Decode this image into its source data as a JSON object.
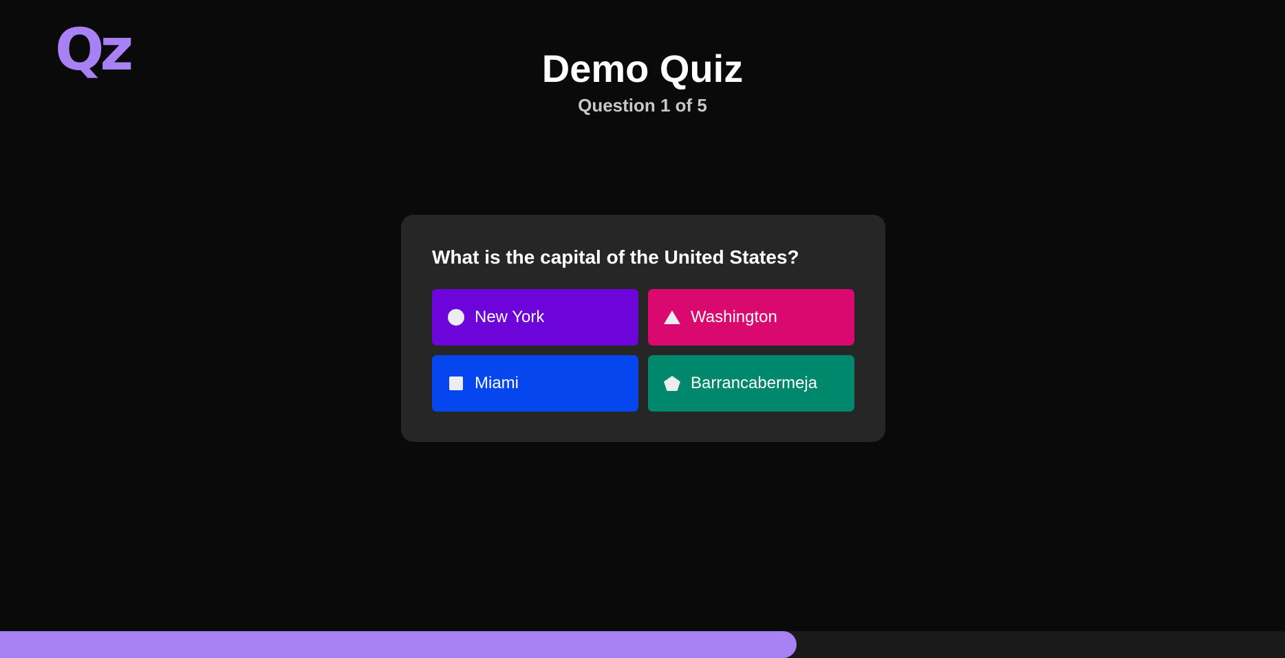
{
  "logo": {
    "text": "Qz",
    "color": "#a882f5"
  },
  "header": {
    "title": "Demo Quiz",
    "subtitle": "Question 1 of 5"
  },
  "question": {
    "text": "What is the capital of the United States?",
    "answers": [
      {
        "label": "New York",
        "icon": "circle-icon",
        "color": "#6d05db"
      },
      {
        "label": "Washington",
        "icon": "triangle-icon",
        "color": "#d90970"
      },
      {
        "label": "Miami",
        "icon": "square-icon",
        "color": "#0646ee"
      },
      {
        "label": "Barrancabermeja",
        "icon": "pentagon-icon",
        "color": "#00886d"
      }
    ]
  },
  "progress": {
    "fraction": 0.62,
    "color": "#a882f5"
  }
}
